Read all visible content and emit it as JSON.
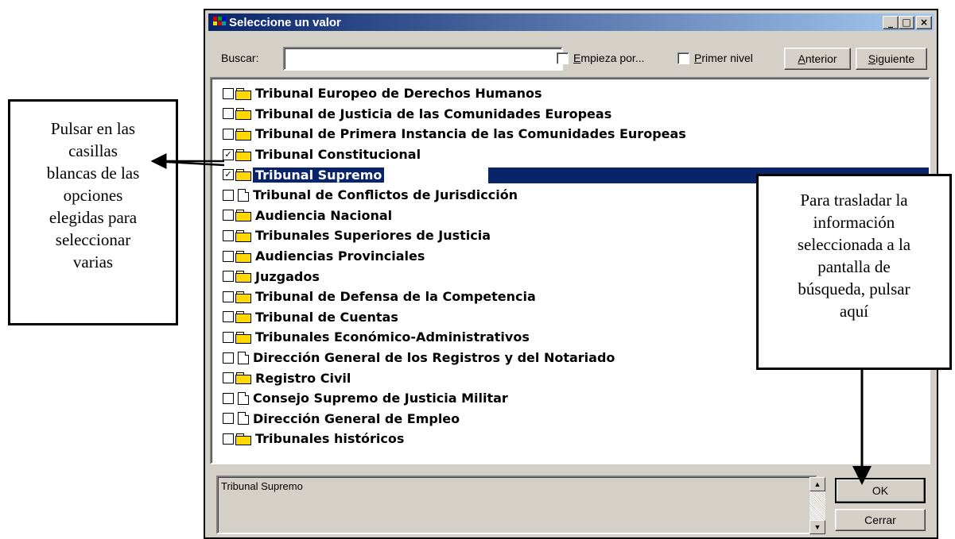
{
  "window": {
    "title": "Seleccione un valor",
    "controls": {
      "minimize": "_",
      "maximize": "□",
      "close": "×"
    }
  },
  "search": {
    "label": "Buscar:",
    "value": "",
    "empieza_pre": "",
    "empieza_u": "E",
    "empieza_rest": "mpieza por...",
    "primer_u": "P",
    "primer_rest": "rimer nivel",
    "anterior_u": "A",
    "anterior_rest": "nterior",
    "siguiente_u": "S",
    "siguiente_rest": "iguiente",
    "empieza_checked": false,
    "primer_checked": false
  },
  "tree": {
    "items": [
      {
        "label": "Tribunal Europeo de Derechos Humanos",
        "icon": "folder",
        "checked": false
      },
      {
        "label": "Tribunal de Justicia de las Comunidades Europeas",
        "icon": "folder",
        "checked": false
      },
      {
        "label": "Tribunal de Primera Instancia de las Comunidades Europeas",
        "icon": "folder",
        "checked": false
      },
      {
        "label": "Tribunal Constitucional",
        "icon": "folder",
        "checked": true
      },
      {
        "label": "Tribunal Supremo",
        "icon": "folder",
        "checked": true,
        "selected": true
      },
      {
        "label": "Tribunal de Conflictos de Jurisdicción",
        "icon": "document",
        "checked": false
      },
      {
        "label": "Audiencia Nacional",
        "icon": "folder",
        "checked": false
      },
      {
        "label": "Tribunales Superiores de Justicia",
        "icon": "folder",
        "checked": false
      },
      {
        "label": "Audiencias Provinciales",
        "icon": "folder",
        "checked": false
      },
      {
        "label": "Juzgados",
        "icon": "folder",
        "checked": false
      },
      {
        "label": "Tribunal de Defensa de la Competencia",
        "icon": "folder",
        "checked": false
      },
      {
        "label": "Tribunal de Cuentas",
        "icon": "folder",
        "checked": false
      },
      {
        "label": "Tribunales Económico-Administrativos",
        "icon": "folder",
        "checked": false
      },
      {
        "label": "Dirección General de los Registros y del Notariado",
        "icon": "document",
        "checked": false
      },
      {
        "label": "Registro Civil",
        "icon": "folder",
        "checked": false
      },
      {
        "label": "Consejo Supremo de Justicia Militar",
        "icon": "document",
        "checked": false
      },
      {
        "label": "Dirección General de Empleo",
        "icon": "document",
        "checked": false
      },
      {
        "label": "Tribunales históricos",
        "icon": "folder",
        "checked": false
      }
    ]
  },
  "info": {
    "text": "Tribunal Supremo",
    "scroll_up": "▲",
    "scroll_down": "▼"
  },
  "buttons": {
    "ok": "OK",
    "cerrar": "Cerrar"
  },
  "callouts": {
    "left": [
      "Pulsar en las",
      "casillas",
      "blancas de las",
      "opciones",
      "elegidas para",
      "seleccionar",
      "varias"
    ],
    "right": [
      "Para trasladar la",
      "información",
      "seleccionada a la",
      "pantalla de",
      "búsqueda, pulsar",
      "aquí"
    ]
  },
  "colors": {
    "title_start": "#0a246a",
    "title_end": "#a6caf0",
    "dialog_face": "#d4d0c8",
    "selection": "#0a246a",
    "folder": "#ffd800"
  }
}
